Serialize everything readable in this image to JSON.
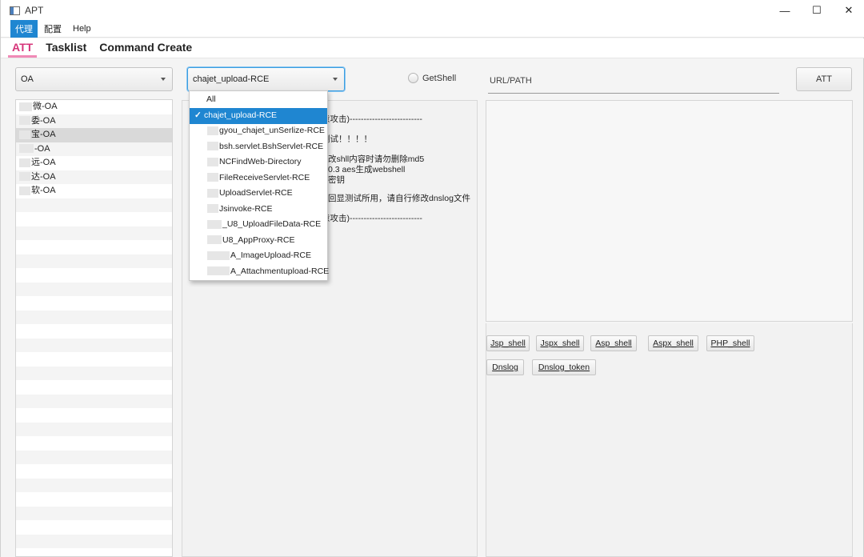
{
  "window": {
    "title": "APT",
    "minimize": "—",
    "maximize": "☐",
    "close": "✕"
  },
  "menu": [
    {
      "label": "代理",
      "active": true
    },
    {
      "label": "配置",
      "active": false
    },
    {
      "label": "Help",
      "active": false
    }
  ],
  "tabs": [
    {
      "label": "ATT",
      "active": true
    },
    {
      "label": "Tasklist",
      "active": false
    },
    {
      "label": "Command Create",
      "active": false
    }
  ],
  "controls": {
    "category_select": "OA",
    "exploit_select": "chajet_upload-RCE",
    "getshell_label": "GetShell",
    "url_placeholder": "URL/PATH",
    "att_button": "ATT"
  },
  "target_list": [
    {
      "label": "微-OA"
    },
    {
      "label": "委-OA"
    },
    {
      "label": "宝-OA"
    },
    {
      "label": "-OA"
    },
    {
      "label": "远-OA"
    },
    {
      "label": "达-OA"
    },
    {
      "label": "软-OA"
    }
  ],
  "dropdown_items": [
    {
      "label": "All",
      "selected": false
    },
    {
      "label": "chajet_upload-RCE",
      "selected": true
    },
    {
      "label": "gyou_chajet_unSerlize-RCE",
      "selected": false
    },
    {
      "label": "bsh.servlet.BshServlet-RCE",
      "selected": false
    },
    {
      "label": "NCFindWeb-Directory",
      "selected": false
    },
    {
      "label": "FileReceiveServlet-RCE",
      "selected": false
    },
    {
      "label": "UploadServlet-RCE",
      "selected": false
    },
    {
      "label": "Jsinvoke-RCE",
      "selected": false
    },
    {
      "label": "_U8_UploadFileData-RCE",
      "selected": false
    },
    {
      "label": "U8_AppProxy-RCE",
      "selected": false
    },
    {
      "label": "A_ImageUpload-RCE",
      "selected": false
    },
    {
      "label": "A_Attachmentupload-RCE",
      "selected": false
    }
  ],
  "info_lines": [
    "意攻击)--------------------------",
    "测试！！！！",
    "改shll内容时请勿删除md5",
    "0.3 aes生成webshell",
    "密钥",
    "回显测试所用，请自行修改dnslog文件",
    "意攻击)--------------------------"
  ],
  "shell_buttons": [
    "Jsp_shell",
    "Jspx_shell",
    "Asp_shell",
    "Aspx_shell",
    "PHP_shell"
  ],
  "dns_buttons": [
    "Dnslog",
    "Dnslog_token"
  ],
  "checkmark": "✓"
}
